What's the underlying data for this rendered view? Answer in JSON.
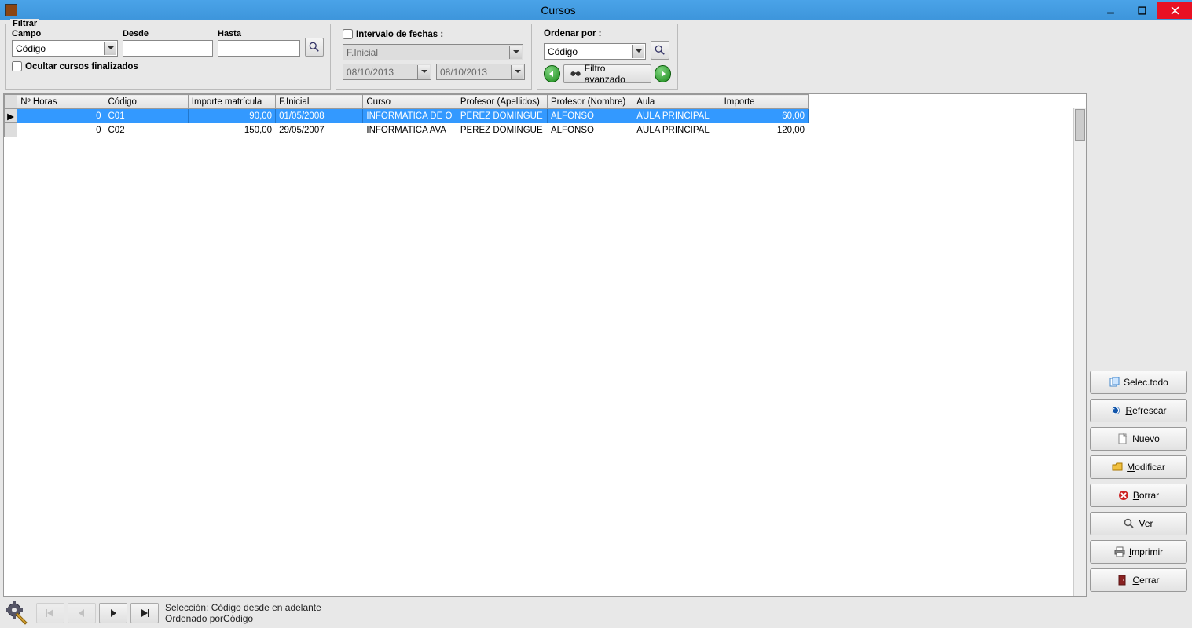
{
  "window": {
    "title": "Cursos"
  },
  "filter": {
    "group_title": "Filtrar",
    "campo_label": "Campo",
    "campo_value": "Código",
    "desde_label": "Desde",
    "desde_value": "",
    "hasta_label": "Hasta",
    "hasta_value": "",
    "hide_finished_label": "Ocultar cursos finalizados"
  },
  "intervalo": {
    "title": "Intervalo de fechas :",
    "combo_value": "F.Inicial",
    "date_from": "08/10/2013",
    "date_to": "08/10/2013"
  },
  "ordenar": {
    "title": "Ordenar por :",
    "value": "Código",
    "filtro_avanzado_label": "Filtro avanzado"
  },
  "grid": {
    "columns": [
      "Nº Horas",
      "Código",
      "Importe matrícula",
      "F.Inicial",
      "Curso",
      "Profesor (Apellidos)",
      "Profesor (Nombre)",
      "Aula",
      "Importe"
    ],
    "rows": [
      {
        "selected": true,
        "marker": "▶",
        "horas": "0",
        "codigo": "C01",
        "matricula": "90,00",
        "finicial": "01/05/2008",
        "curso": "INFORMATICA DE O",
        "prof_ap": "PEREZ DOMINGUE",
        "prof_no": "ALFONSO",
        "aula": "AULA PRINCIPAL",
        "importe": "60,00"
      },
      {
        "selected": false,
        "marker": "",
        "horas": "0",
        "codigo": "C02",
        "matricula": "150,00",
        "finicial": "29/05/2007",
        "curso": "INFORMATICA AVA",
        "prof_ap": "PEREZ DOMINGUE",
        "prof_no": "ALFONSO",
        "aula": "AULA PRINCIPAL",
        "importe": "120,00"
      }
    ]
  },
  "sidebar": {
    "select_all": "Selec.todo",
    "refresh": "Refrescar",
    "new": "Nuevo",
    "modify": "Modificar",
    "delete": "Borrar",
    "view": "Ver",
    "print": "Imprimir",
    "close": "Cerrar"
  },
  "status": {
    "line1": "Selección: Código desde  en adelante",
    "line2": "Ordenado porCódigo"
  }
}
